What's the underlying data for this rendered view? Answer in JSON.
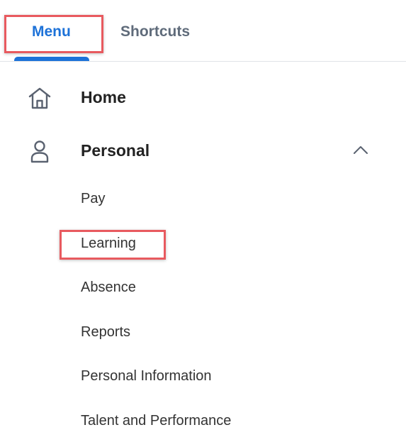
{
  "tabs": {
    "menu_label": "Menu",
    "shortcuts_label": "Shortcuts",
    "active": "Menu"
  },
  "nav": {
    "home_label": "Home",
    "personal_label": "Personal",
    "personal_expanded": true,
    "personal_items": [
      "Pay",
      "Learning",
      "Absence",
      "Reports",
      "Personal Information",
      "Talent and Performance"
    ]
  },
  "colors": {
    "accent": "#1d72d8",
    "highlight": "#e85a5f",
    "inactive_tab": "#5f6b7a",
    "icon": "#5a6270"
  },
  "icons": {
    "home": "home-icon",
    "personal": "person-icon",
    "expand": "chevron-up-icon"
  }
}
